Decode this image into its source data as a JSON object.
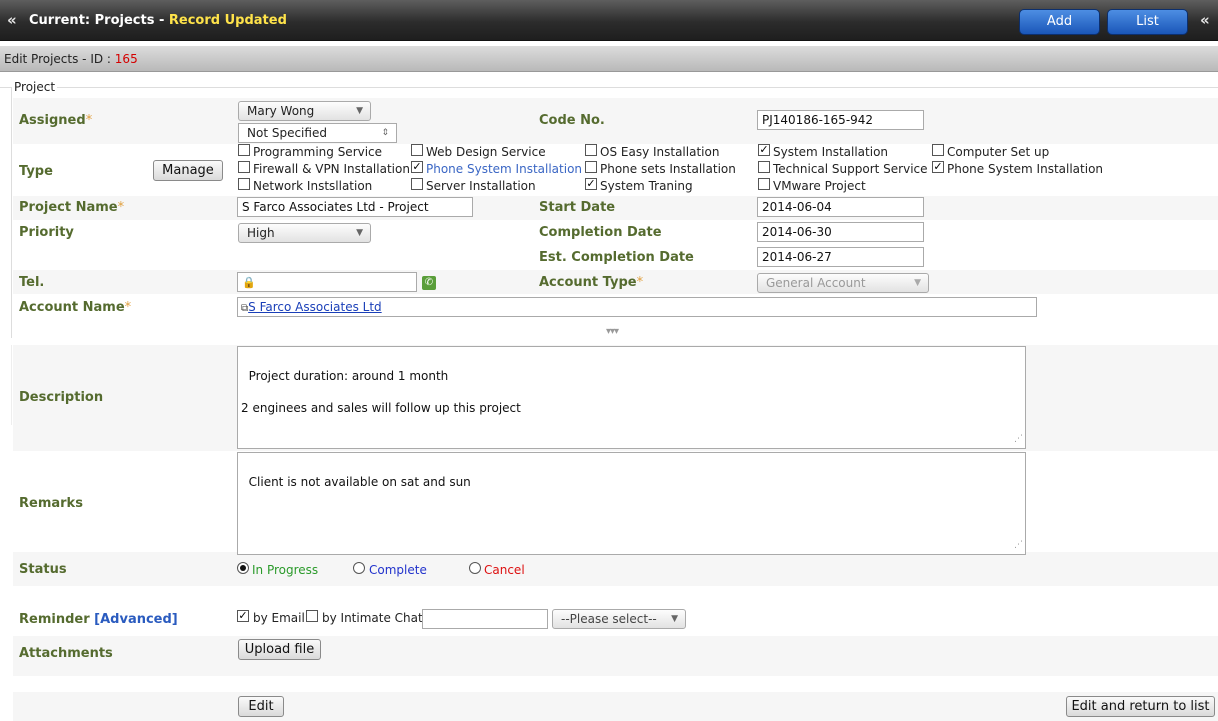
{
  "header": {
    "left_chevron": "«",
    "right_chevron": "«",
    "title": "Current: Projects -",
    "status": "Record Updated",
    "add_label": "Add",
    "list_label": "List"
  },
  "subheader": {
    "label": "Edit Projects - ID :",
    "id": "165"
  },
  "section": {
    "legend": "Project"
  },
  "form": {
    "assigned": {
      "label": "Assigned",
      "value": "Mary Wong",
      "second_value": "Not Specified"
    },
    "code": {
      "label": "Code No.",
      "value": "PJ140186-165-942"
    },
    "type": {
      "label": "Type",
      "manage_label": "Manage",
      "options": [
        {
          "label": "Programming Service",
          "checked": false
        },
        {
          "label": "Web Design Service",
          "checked": false
        },
        {
          "label": "OS Easy Installation",
          "checked": false
        },
        {
          "label": "System Installation",
          "checked": true
        },
        {
          "label": "Computer Set up",
          "checked": false
        },
        {
          "label": "Firewall & VPN Installation",
          "checked": false
        },
        {
          "label": "Phone System Installation",
          "checked": true
        },
        {
          "label": "Phone sets Installation",
          "checked": false
        },
        {
          "label": "Technical Support Service",
          "checked": false
        },
        {
          "label": "Phone System Installation",
          "checked": true
        },
        {
          "label": "Network Instsllation",
          "checked": false
        },
        {
          "label": "Server Installation",
          "checked": false
        },
        {
          "label": "System Traning",
          "checked": true
        },
        {
          "label": "VMware Project",
          "checked": false
        }
      ]
    },
    "project_name": {
      "label": "Project Name",
      "value": "S Farco Associates Ltd - Project"
    },
    "start_date": {
      "label": "Start Date",
      "value": "2014-06-04"
    },
    "priority": {
      "label": "Priority",
      "value": "High"
    },
    "completion_date": {
      "label": "Completion Date",
      "value": "2014-06-30"
    },
    "est_completion_date": {
      "label": "Est. Completion Date",
      "value": "2014-06-27"
    },
    "tel": {
      "label": "Tel.",
      "value": ""
    },
    "account_type": {
      "label": "Account Type",
      "value": "General Account"
    },
    "account_name": {
      "label": "Account Name",
      "value": "S Farco Associates Ltd"
    },
    "collapse_toggle": "▾▾▾",
    "description": {
      "label": "Description",
      "value": "Project duration: around 1 month\n\n2 enginees and sales will follow up this project"
    },
    "remarks": {
      "label": "Remarks",
      "value": "Client is not available on sat and sun"
    },
    "status": {
      "label": "Status",
      "options": [
        {
          "label": "In Progress",
          "color": "#2a9a2a",
          "selected": true
        },
        {
          "label": "Complete",
          "color": "#2233cc",
          "selected": false
        },
        {
          "label": "Cancel",
          "color": "#dd1111",
          "selected": false
        }
      ]
    },
    "reminder": {
      "label": "Reminder",
      "advanced_label": "[Advanced]",
      "by_email": "by Email",
      "by_chat": "by Intimate Chat",
      "select_placeholder": "--Please select--"
    },
    "attachments": {
      "label": "Attachments",
      "upload_label": "Upload file"
    }
  },
  "footer": {
    "edit_label": "Edit",
    "edit_return_label": "Edit and return to list"
  },
  "colors": {
    "label": "#556b2f",
    "required": "#e0a040",
    "accent": "#1a56b8",
    "status_updated": "#ffe34a"
  }
}
